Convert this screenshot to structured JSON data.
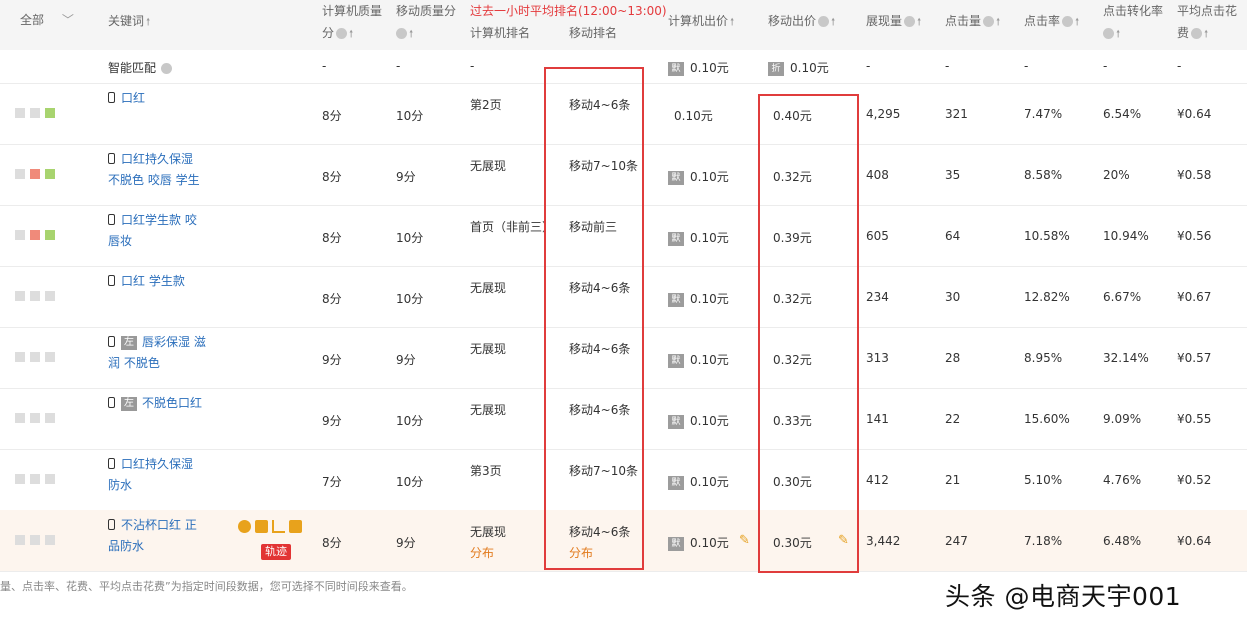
{
  "header": {
    "all": "全部",
    "keyword": "关键词",
    "pc_quality": [
      "计算机质量",
      "分"
    ],
    "mobile_quality": "移动质量分",
    "past_hour": "过去一小时平均排名(12:00~13:00)",
    "pc_rank": "计算机排名",
    "mobile_rank": "移动排名",
    "pc_bid": "计算机出价",
    "mobile_bid": "移动出价",
    "impressions": "展现量",
    "clicks": "点击量",
    "ctr": "点击率",
    "cvr": "点击转化率",
    "cpc": [
      "平均点击花",
      "费"
    ]
  },
  "smart_match": {
    "label": "智能匹配",
    "pc_quality": "-",
    "mobile_quality": "-",
    "pc_rank": "-",
    "badge1": "默",
    "pc_bid": "0.10元",
    "badge2": "折",
    "mobile_bid": "0.10元",
    "impressions": "-",
    "clicks": "-",
    "ctr": "-",
    "cvr": "-",
    "cpc": "-"
  },
  "rows": [
    {
      "kw1": "口红",
      "kw2": "",
      "tag": "",
      "pc_q": "8分",
      "m_q": "10分",
      "pc_rank": "第2页",
      "m_rank": "移动4~6条",
      "pc_bid": "0.10元",
      "m_bid": "0.40元",
      "impr": "4,295",
      "clicks": "321",
      "ctr": "7.47%",
      "cvr": "6.54%",
      "cpc": "¥0.64"
    },
    {
      "kw1": "口红持久保湿",
      "kw2": "不脱色 咬唇 学生",
      "tag": "",
      "pc_q": "8分",
      "m_q": "9分",
      "pc_rank": "无展现",
      "m_rank": "移动7~10条",
      "pc_bid": "0.10元",
      "m_bid": "0.32元",
      "impr": "408",
      "clicks": "35",
      "ctr": "8.58%",
      "cvr": "20%",
      "cpc": "¥0.58"
    },
    {
      "kw1": "口红学生款 咬",
      "kw2": "唇妆",
      "tag": "",
      "pc_q": "8分",
      "m_q": "10分",
      "pc_rank": "首页（非前三）",
      "m_rank": "移动前三",
      "pc_bid": "0.10元",
      "m_bid": "0.39元",
      "impr": "605",
      "clicks": "64",
      "ctr": "10.58%",
      "cvr": "10.94%",
      "cpc": "¥0.56"
    },
    {
      "kw1": "口红 学生款",
      "kw2": "",
      "tag": "",
      "pc_q": "8分",
      "m_q": "10分",
      "pc_rank": "无展现",
      "m_rank": "移动4~6条",
      "pc_bid": "0.10元",
      "m_bid": "0.32元",
      "impr": "234",
      "clicks": "30",
      "ctr": "12.82%",
      "cvr": "6.67%",
      "cpc": "¥0.67"
    },
    {
      "kw1": "唇彩保湿 滋",
      "kw2": "润 不脱色",
      "tag": "左",
      "pc_q": "9分",
      "m_q": "9分",
      "pc_rank": "无展现",
      "m_rank": "移动4~6条",
      "pc_bid": "0.10元",
      "m_bid": "0.32元",
      "impr": "313",
      "clicks": "28",
      "ctr": "8.95%",
      "cvr": "32.14%",
      "cpc": "¥0.57"
    },
    {
      "kw1": "不脱色口红",
      "kw2": "",
      "tag": "左",
      "pc_q": "9分",
      "m_q": "10分",
      "pc_rank": "无展现",
      "m_rank": "移动4~6条",
      "pc_bid": "0.10元",
      "m_bid": "0.33元",
      "impr": "141",
      "clicks": "22",
      "ctr": "15.60%",
      "cvr": "9.09%",
      "cpc": "¥0.55"
    },
    {
      "kw1": "口红持久保湿",
      "kw2": "防水",
      "tag": "",
      "pc_q": "7分",
      "m_q": "10分",
      "pc_rank": "第3页",
      "m_rank": "移动7~10条",
      "pc_bid": "0.10元",
      "m_bid": "0.30元",
      "impr": "412",
      "clicks": "21",
      "ctr": "5.10%",
      "cvr": "4.76%",
      "cpc": "¥0.52"
    },
    {
      "kw1": "不沾杯口红 正",
      "kw2": "品防水",
      "tag": "",
      "pc_q": "8分",
      "m_q": "9分",
      "pc_rank": "无展现",
      "m_rank": "移动4~6条",
      "pc_bid": "0.10元",
      "m_bid": "0.30元",
      "impr": "3,442",
      "clicks": "247",
      "ctr": "7.18%",
      "cvr": "6.48%",
      "cpc": "¥0.64",
      "dist": "分布",
      "trail": "轨迹"
    }
  ],
  "pc_bid_badge": "默",
  "row_status": [
    [
      "#ddd",
      "#ddd",
      "#a8d46f"
    ],
    [
      "#ddd",
      "#f08a7a",
      "#a8d46f"
    ],
    [
      "#ddd",
      "#f08a7a",
      "#a8d46f"
    ],
    [
      "#ddd",
      "#ddd",
      "#ddd"
    ],
    [
      "#ddd",
      "#ddd",
      "#ddd"
    ],
    [
      "#ddd",
      "#ddd",
      "#ddd"
    ],
    [
      "#ddd",
      "#ddd",
      "#ddd"
    ],
    [
      "#ddd",
      "#ddd",
      "#ddd"
    ]
  ],
  "footnote": "量、点击率、花费、平均点击花费”为指定时间段数据，您可选择不同时间段来查看。",
  "watermark": "头条 @电商天宇001"
}
